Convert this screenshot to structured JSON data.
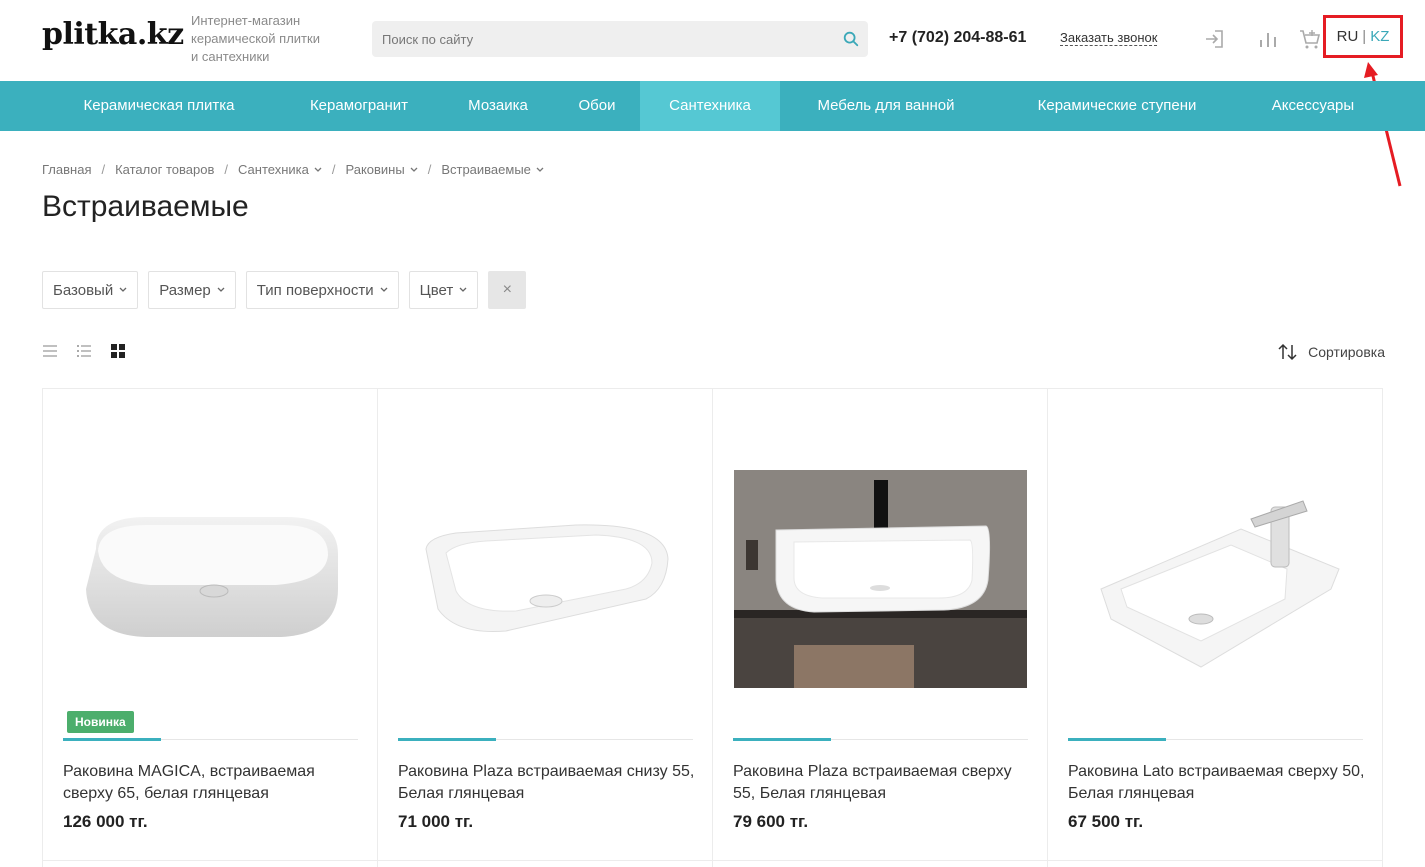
{
  "header": {
    "logo": "plitka.kz",
    "tagline_lines": [
      "Интернет-магазин",
      "керамической плитки",
      "и сантехники"
    ],
    "search_placeholder": "Поиск по сайту",
    "phone": "+7 (702) 204-88-61",
    "callback": "Заказать звонок",
    "icons": [
      "login-icon",
      "compare-icon",
      "cart-icon"
    ],
    "lang": {
      "ru": "RU",
      "sep": "|",
      "kz": "KZ"
    }
  },
  "nav": {
    "items": [
      {
        "label": "Керамическая плитка"
      },
      {
        "label": "Керамогранит"
      },
      {
        "label": "Мозаика"
      },
      {
        "label": "Обои"
      },
      {
        "label": "Сантехника"
      },
      {
        "label": "Мебель для ванной"
      },
      {
        "label": "Керамические ступени"
      },
      {
        "label": "Аксессуары"
      }
    ],
    "active_index": 4
  },
  "breadcrumb": [
    "Главная",
    "Каталог товаров",
    "Сантехника",
    "Раковины",
    "Встраиваемые"
  ],
  "page_title": "Встраиваемые",
  "filters": [
    "Базовый",
    "Размер",
    "Тип поверхности",
    "Цвет"
  ],
  "filter_clear": "×",
  "sort_label": "Сортировка",
  "products": [
    {
      "name": "Раковина MAGICA, встраиваемая сверху 65, белая глянцевая",
      "price": "126 000 тг.",
      "badge": "Новинка"
    },
    {
      "name": "Раковина Plaza встраиваемая снизу 55, Белая глянцевая",
      "price": "71 000 тг."
    },
    {
      "name": "Раковина Plaza встраиваемая сверху 55, Белая глянцевая",
      "price": "79 600 тг."
    },
    {
      "name": "Раковина Lato встраиваемая сверху 50, Белая глянцевая",
      "price": "67 500 тг."
    }
  ],
  "colors": {
    "accent": "#3bb0be",
    "nav_active": "#55c8d3",
    "badge": "#4cae6c",
    "annotation": "#e51c23"
  }
}
